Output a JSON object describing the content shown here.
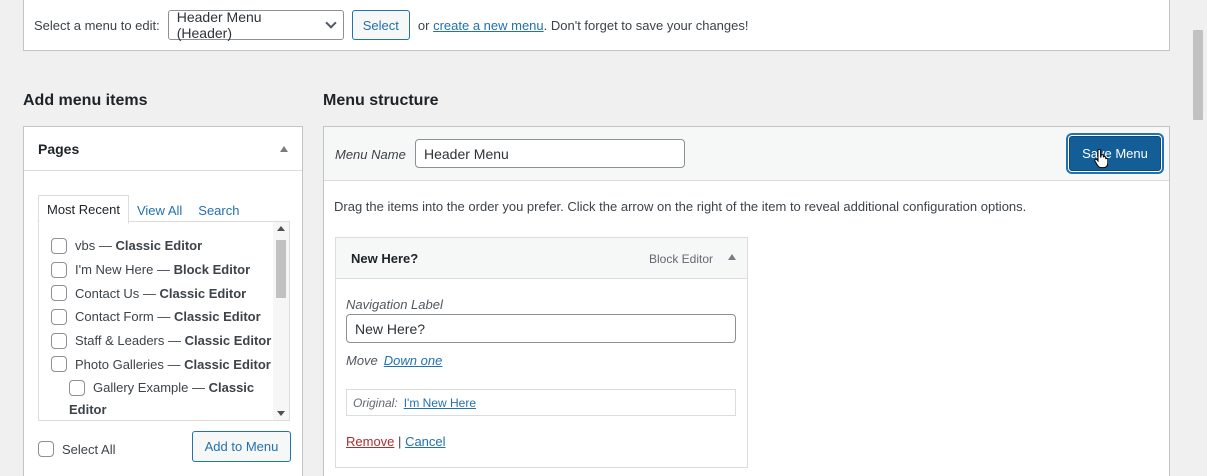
{
  "topbar": {
    "select_label": "Select a menu to edit:",
    "selected_menu": "Header Menu (Header)",
    "select_button": "Select",
    "or_text": "or",
    "create_link": "create a new menu",
    "reminder": ". Don't forget to save your changes!"
  },
  "add_items": {
    "heading": "Add menu items",
    "pages_title": "Pages",
    "tabs": [
      "Most Recent",
      "View All",
      "Search"
    ],
    "pages": [
      {
        "name": "vbs",
        "editor": "Classic Editor"
      },
      {
        "name": "I'm New Here",
        "editor": "Block Editor"
      },
      {
        "name": "Contact Us",
        "editor": "Classic Editor"
      },
      {
        "name": "Contact Form",
        "editor": "Classic Editor"
      },
      {
        "name": "Staff & Leaders",
        "editor": "Classic Editor"
      },
      {
        "name": "Photo Galleries",
        "editor": "Classic Editor"
      },
      {
        "name": "Gallery Example",
        "editor": "Classic",
        "editor_wrap": "Editor"
      }
    ],
    "separator": " — ",
    "select_all": "Select All",
    "add_button": "Add to Menu"
  },
  "structure": {
    "heading": "Menu structure",
    "menu_name_label": "Menu Name",
    "menu_name_value": "Header Menu",
    "save_button": "Save Menu",
    "drag_note": "Drag the items into the order you prefer. Click the arrow on the right of the item to reveal additional configuration options.",
    "item": {
      "title": "New Here?",
      "type": "Block Editor",
      "nav_label_label": "Navigation Label",
      "nav_label_value": "New Here?",
      "move_label": "Move",
      "move_link": "Down one",
      "original_label": "Original:",
      "original_link": "I'm New Here",
      "remove": "Remove",
      "pipe": "|",
      "cancel": "Cancel"
    }
  },
  "colors": {
    "accent": "#2271b1",
    "primary_button": "#135e96",
    "danger": "#b32d2e"
  }
}
